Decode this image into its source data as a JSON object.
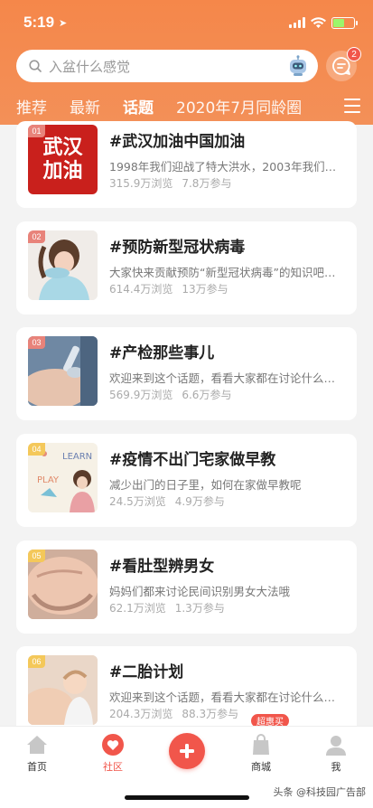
{
  "status_bar": {
    "time": "5:19",
    "battery_level": 0.55
  },
  "search": {
    "placeholder": "入盆什么感觉",
    "message_badge": "2"
  },
  "tabs": [
    {
      "label": "推荐",
      "active": false
    },
    {
      "label": "最新",
      "active": false
    },
    {
      "label": "话题",
      "active": true
    },
    {
      "label": "2020年7月同龄圈",
      "active": false
    }
  ],
  "colors": {
    "header": "#f5874a",
    "accent": "#f1564b",
    "rank_1": "#e8837a",
    "rank_4": "#f4c85a"
  },
  "topics": [
    {
      "rank": "01",
      "title": "#武汉加油中国加油",
      "desc": "1998年我们迎战了特大洪水，2003年我们迎战了非典…",
      "views": "315.9万浏览",
      "joins": "7.8万参与",
      "thumb": "wuhan",
      "thumb_text": [
        "武汉",
        "加油"
      ]
    },
    {
      "rank": "02",
      "title": "#预防新型冠状病毒",
      "desc": "大家快来贡献预防“新型冠状病毒”的知识吧…",
      "views": "614.4万浏览",
      "joins": "13万参与",
      "thumb": "child"
    },
    {
      "rank": "03",
      "title": "#产检那些事儿",
      "desc": "欢迎来到这个话题，看看大家都在讨论什么吧…",
      "views": "569.9万浏览",
      "joins": "6.6万参与",
      "thumb": "ultrasound"
    },
    {
      "rank": "04",
      "title": "#疫情不出门宅家做早教",
      "desc": "减少出门的日子里，如何在家做早教呢",
      "views": "24.5万浏览",
      "joins": "4.9万参与",
      "thumb": "learn",
      "thumb_text": [
        "LEARN",
        "PLAY"
      ]
    },
    {
      "rank": "05",
      "title": "#看肚型辨男女",
      "desc": "妈妈们都来讨论民间识别男女大法哦",
      "views": "62.1万浏览",
      "joins": "1.3万参与",
      "thumb": "belly"
    },
    {
      "rank": "06",
      "title": "#二胎计划",
      "desc": "欢迎来到这个话题，看看大家都在讨论什么吧…",
      "views": "204.3万浏览",
      "joins": "88.3万参与",
      "thumb": "baby"
    }
  ],
  "tabbar": {
    "home": "首页",
    "community": "社区",
    "mall": "商城",
    "me": "我",
    "promo": "超惠买"
  },
  "watermark": "头条 @科技园广告部"
}
